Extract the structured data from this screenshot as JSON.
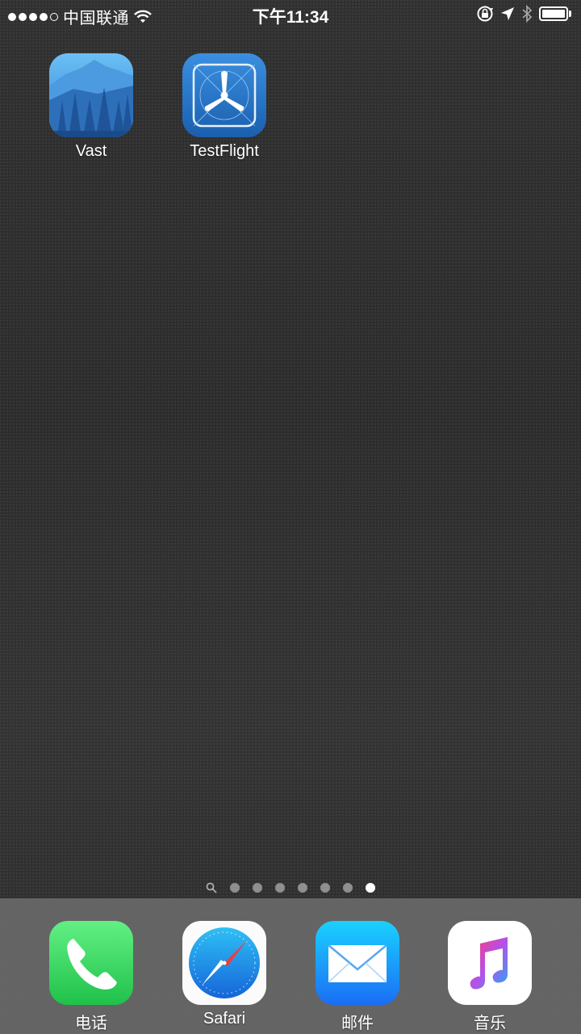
{
  "status_bar": {
    "carrier": "中国联通",
    "time": "下午11:34",
    "signal_strength": 4,
    "signal_max": 5,
    "battery_level": 1.0
  },
  "home_apps": [
    {
      "label": "Vast",
      "icon": "vast-mountain-icon"
    },
    {
      "label": "TestFlight",
      "icon": "testflight-propeller-icon"
    }
  ],
  "page_indicator": {
    "total_pages": 7,
    "current_page": 7,
    "spotlight_icon": "search-icon"
  },
  "dock": {
    "apps": [
      {
        "label": "电话",
        "icon": "phone-icon"
      },
      {
        "label": "Safari",
        "icon": "safari-compass-icon"
      },
      {
        "label": "邮件",
        "icon": "mail-icon"
      },
      {
        "label": "音乐",
        "icon": "music-note-icon"
      }
    ]
  },
  "colors": {
    "phone_green": "#3dd66a",
    "safari_blue": "#1e88e5",
    "mail_blue": "#1e90ff",
    "testflight_blue": "#1f6fc0",
    "vast_blue": "#3a8ed8"
  }
}
